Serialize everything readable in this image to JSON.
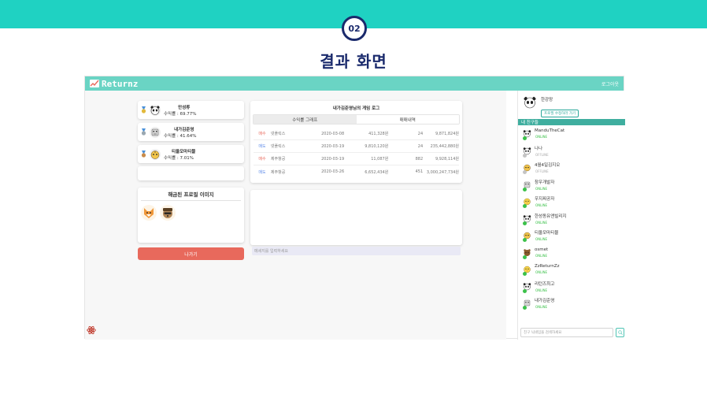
{
  "banner": {
    "step_number": "02",
    "title": "결과 화면"
  },
  "app": {
    "brand": "Returnz",
    "logout_label": "로그아웃",
    "ranking": [
      {
        "name": "만성류",
        "rate": "수익률 : 69.77%",
        "medal_color": "#e2b93b"
      },
      {
        "name": "내가김준영",
        "rate": "수익률 : 41.64%",
        "medal_color": "#9aa7b0"
      },
      {
        "name": "티올모마티뮬",
        "rate": "수익률 : 7.01%",
        "medal_color": "#c98b4a"
      }
    ],
    "profile_unlock": {
      "title": "해금된 프로필 이미지",
      "icons": [
        "fox-icon",
        "raccoon-icon"
      ]
    },
    "exit_label": "나가기",
    "log": {
      "title": "내가김준영님의 게임 로그",
      "tabs": [
        "수익률 그래프",
        "매매내역"
      ],
      "rows": [
        {
          "type": "매수",
          "name": "넷플릭스",
          "date": "2020-03-08",
          "price": "411,328원",
          "qty": "24",
          "total": "9,871,824원"
        },
        {
          "type": "매도",
          "name": "넷플릭스",
          "date": "2020-03-19",
          "price": "9,810,120원",
          "qty": "24",
          "total": "235,442,880원"
        },
        {
          "type": "매수",
          "name": "제주항공",
          "date": "2020-03-19",
          "price": "11,087원",
          "qty": "882",
          "total": "9,928,114원"
        },
        {
          "type": "매도",
          "name": "제주항공",
          "date": "2020-03-26",
          "price": "6,652,434원",
          "qty": "451",
          "total": "3,000,247,734원"
        }
      ]
    },
    "chat_placeholder": "메세지를 입력하세요",
    "me": {
      "name": "한강망",
      "edit_label": "프로필 수정하러 가기"
    },
    "friends_header": "내 친구들",
    "friends": [
      {
        "name": "ManduTheCat",
        "status": "ONLINE",
        "online": true,
        "avatar": "panda-icon"
      },
      {
        "name": "나나",
        "status": "OFFLINE",
        "online": false,
        "avatar": "panda-icon"
      },
      {
        "name": "4월4일김지오",
        "status": "OFFLINE",
        "online": false,
        "avatar": "tiger-icon"
      },
      {
        "name": "창우개발자",
        "status": "ONLINE",
        "online": true,
        "avatar": "robot-icon"
      },
      {
        "name": "우지찌공자",
        "status": "ONLINE",
        "online": true,
        "avatar": "chick-icon"
      },
      {
        "name": "한성동유앤빌리지",
        "status": "ONLINE",
        "online": true,
        "avatar": "panda-icon"
      },
      {
        "name": "티올모마티뮬",
        "status": "ONLINE",
        "online": true,
        "avatar": "tiger-icon"
      },
      {
        "name": "osmet",
        "status": "ONLINE",
        "online": true,
        "avatar": "bear-icon"
      },
      {
        "name": "ZzReturnZz",
        "status": "ONLINE",
        "online": true,
        "avatar": "chick-icon"
      },
      {
        "name": "리턴즈최고",
        "status": "ONLINE",
        "online": true,
        "avatar": "panda-icon"
      },
      {
        "name": "내가김준영",
        "status": "ONLINE",
        "online": true,
        "avatar": "robot-icon"
      }
    ],
    "search_placeholder": "친구 닉네임을 검색하세요"
  }
}
